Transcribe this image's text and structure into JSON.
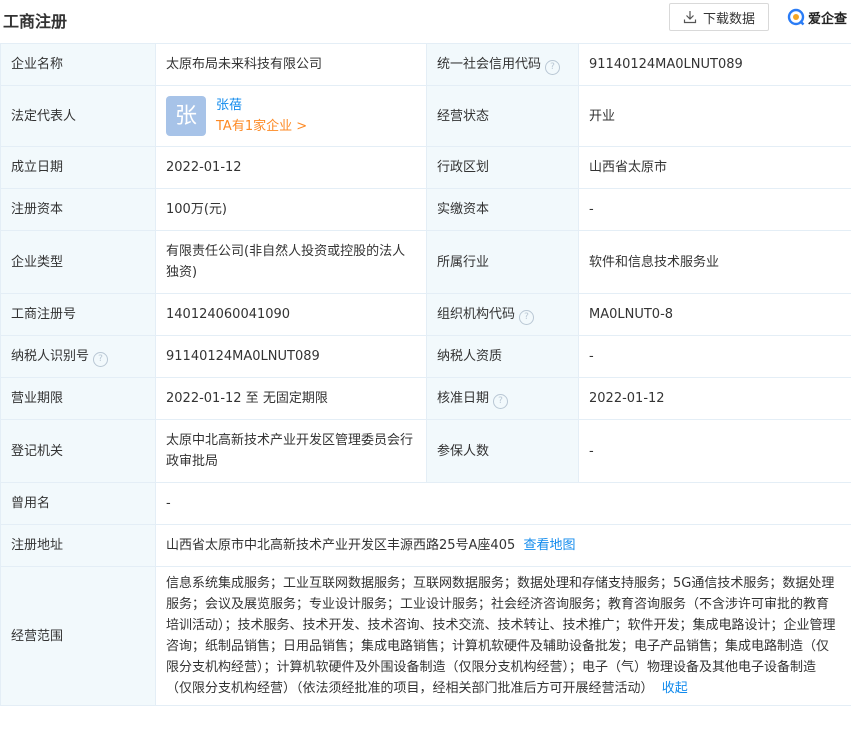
{
  "header": {
    "title": "工商注册",
    "download_label": "下载数据",
    "brand": "爱企查"
  },
  "rows": {
    "company_name": {
      "label": "企业名称",
      "value": "太原布局未来科技有限公司"
    },
    "credit_code": {
      "label": "统一社会信用代码",
      "value": "91140124MA0LNUT089"
    },
    "legal_rep": {
      "label": "法定代表人",
      "avatar_char": "张",
      "name": "张蓓",
      "link": "TA有1家企业 >"
    },
    "status": {
      "label": "经营状态",
      "value": "开业"
    },
    "founded": {
      "label": "成立日期",
      "value": "2022-01-12"
    },
    "region": {
      "label": "行政区划",
      "value": "山西省太原市"
    },
    "reg_capital": {
      "label": "注册资本",
      "value": "100万(元)"
    },
    "paid_capital": {
      "label": "实缴资本",
      "value": "-"
    },
    "company_type": {
      "label": "企业类型",
      "value": "有限责任公司(非自然人投资或控股的法人独资)"
    },
    "industry": {
      "label": "所属行业",
      "value": "软件和信息技术服务业"
    },
    "reg_number": {
      "label": "工商注册号",
      "value": "140124060041090"
    },
    "org_code": {
      "label": "组织机构代码",
      "value": "MA0LNUT0-8"
    },
    "taxpayer_id": {
      "label": "纳税人识别号",
      "value": "91140124MA0LNUT089"
    },
    "taxpayer_qual": {
      "label": "纳税人资质",
      "value": "-"
    },
    "term": {
      "label": "营业期限",
      "value": "2022-01-12 至 无固定期限"
    },
    "approved": {
      "label": "核准日期",
      "value": "2022-01-12"
    },
    "authority": {
      "label": "登记机关",
      "value": "太原中北高新技术产业开发区管理委员会行政审批局"
    },
    "insured": {
      "label": "参保人数",
      "value": "-"
    },
    "former_name": {
      "label": "曾用名",
      "value": "-"
    },
    "address": {
      "label": "注册地址",
      "value": "山西省太原市中北高新技术产业开发区丰源西路25号A座405",
      "map_link": "查看地图"
    },
    "scope": {
      "label": "经营范围",
      "value": "信息系统集成服务；工业互联网数据服务；互联网数据服务；数据处理和存储支持服务；5G通信技术服务；数据处理服务；会议及展览服务；专业设计服务；工业设计服务；社会经济咨询服务；教育咨询服务（不含涉许可审批的教育培训活动）；技术服务、技术开发、技术咨询、技术交流、技术转让、技术推广；软件开发；集成电路设计；企业管理咨询；纸制品销售；日用品销售；集成电路销售；计算机软硬件及辅助设备批发；电子产品销售；集成电路制造（仅限分支机构经营）；计算机软硬件及外围设备制造（仅限分支机构经营）；电子（气）物理设备及其他电子设备制造（仅限分支机构经营）（依法须经批准的项目，经相关部门批准后方可开展经营活动）",
      "collapse": "收起"
    }
  },
  "help_glyph": "?",
  "colors": {
    "label_bg": "#f2f9fc",
    "border": "#e4eef6",
    "link": "#128bed",
    "orange": "#fd8a25"
  }
}
